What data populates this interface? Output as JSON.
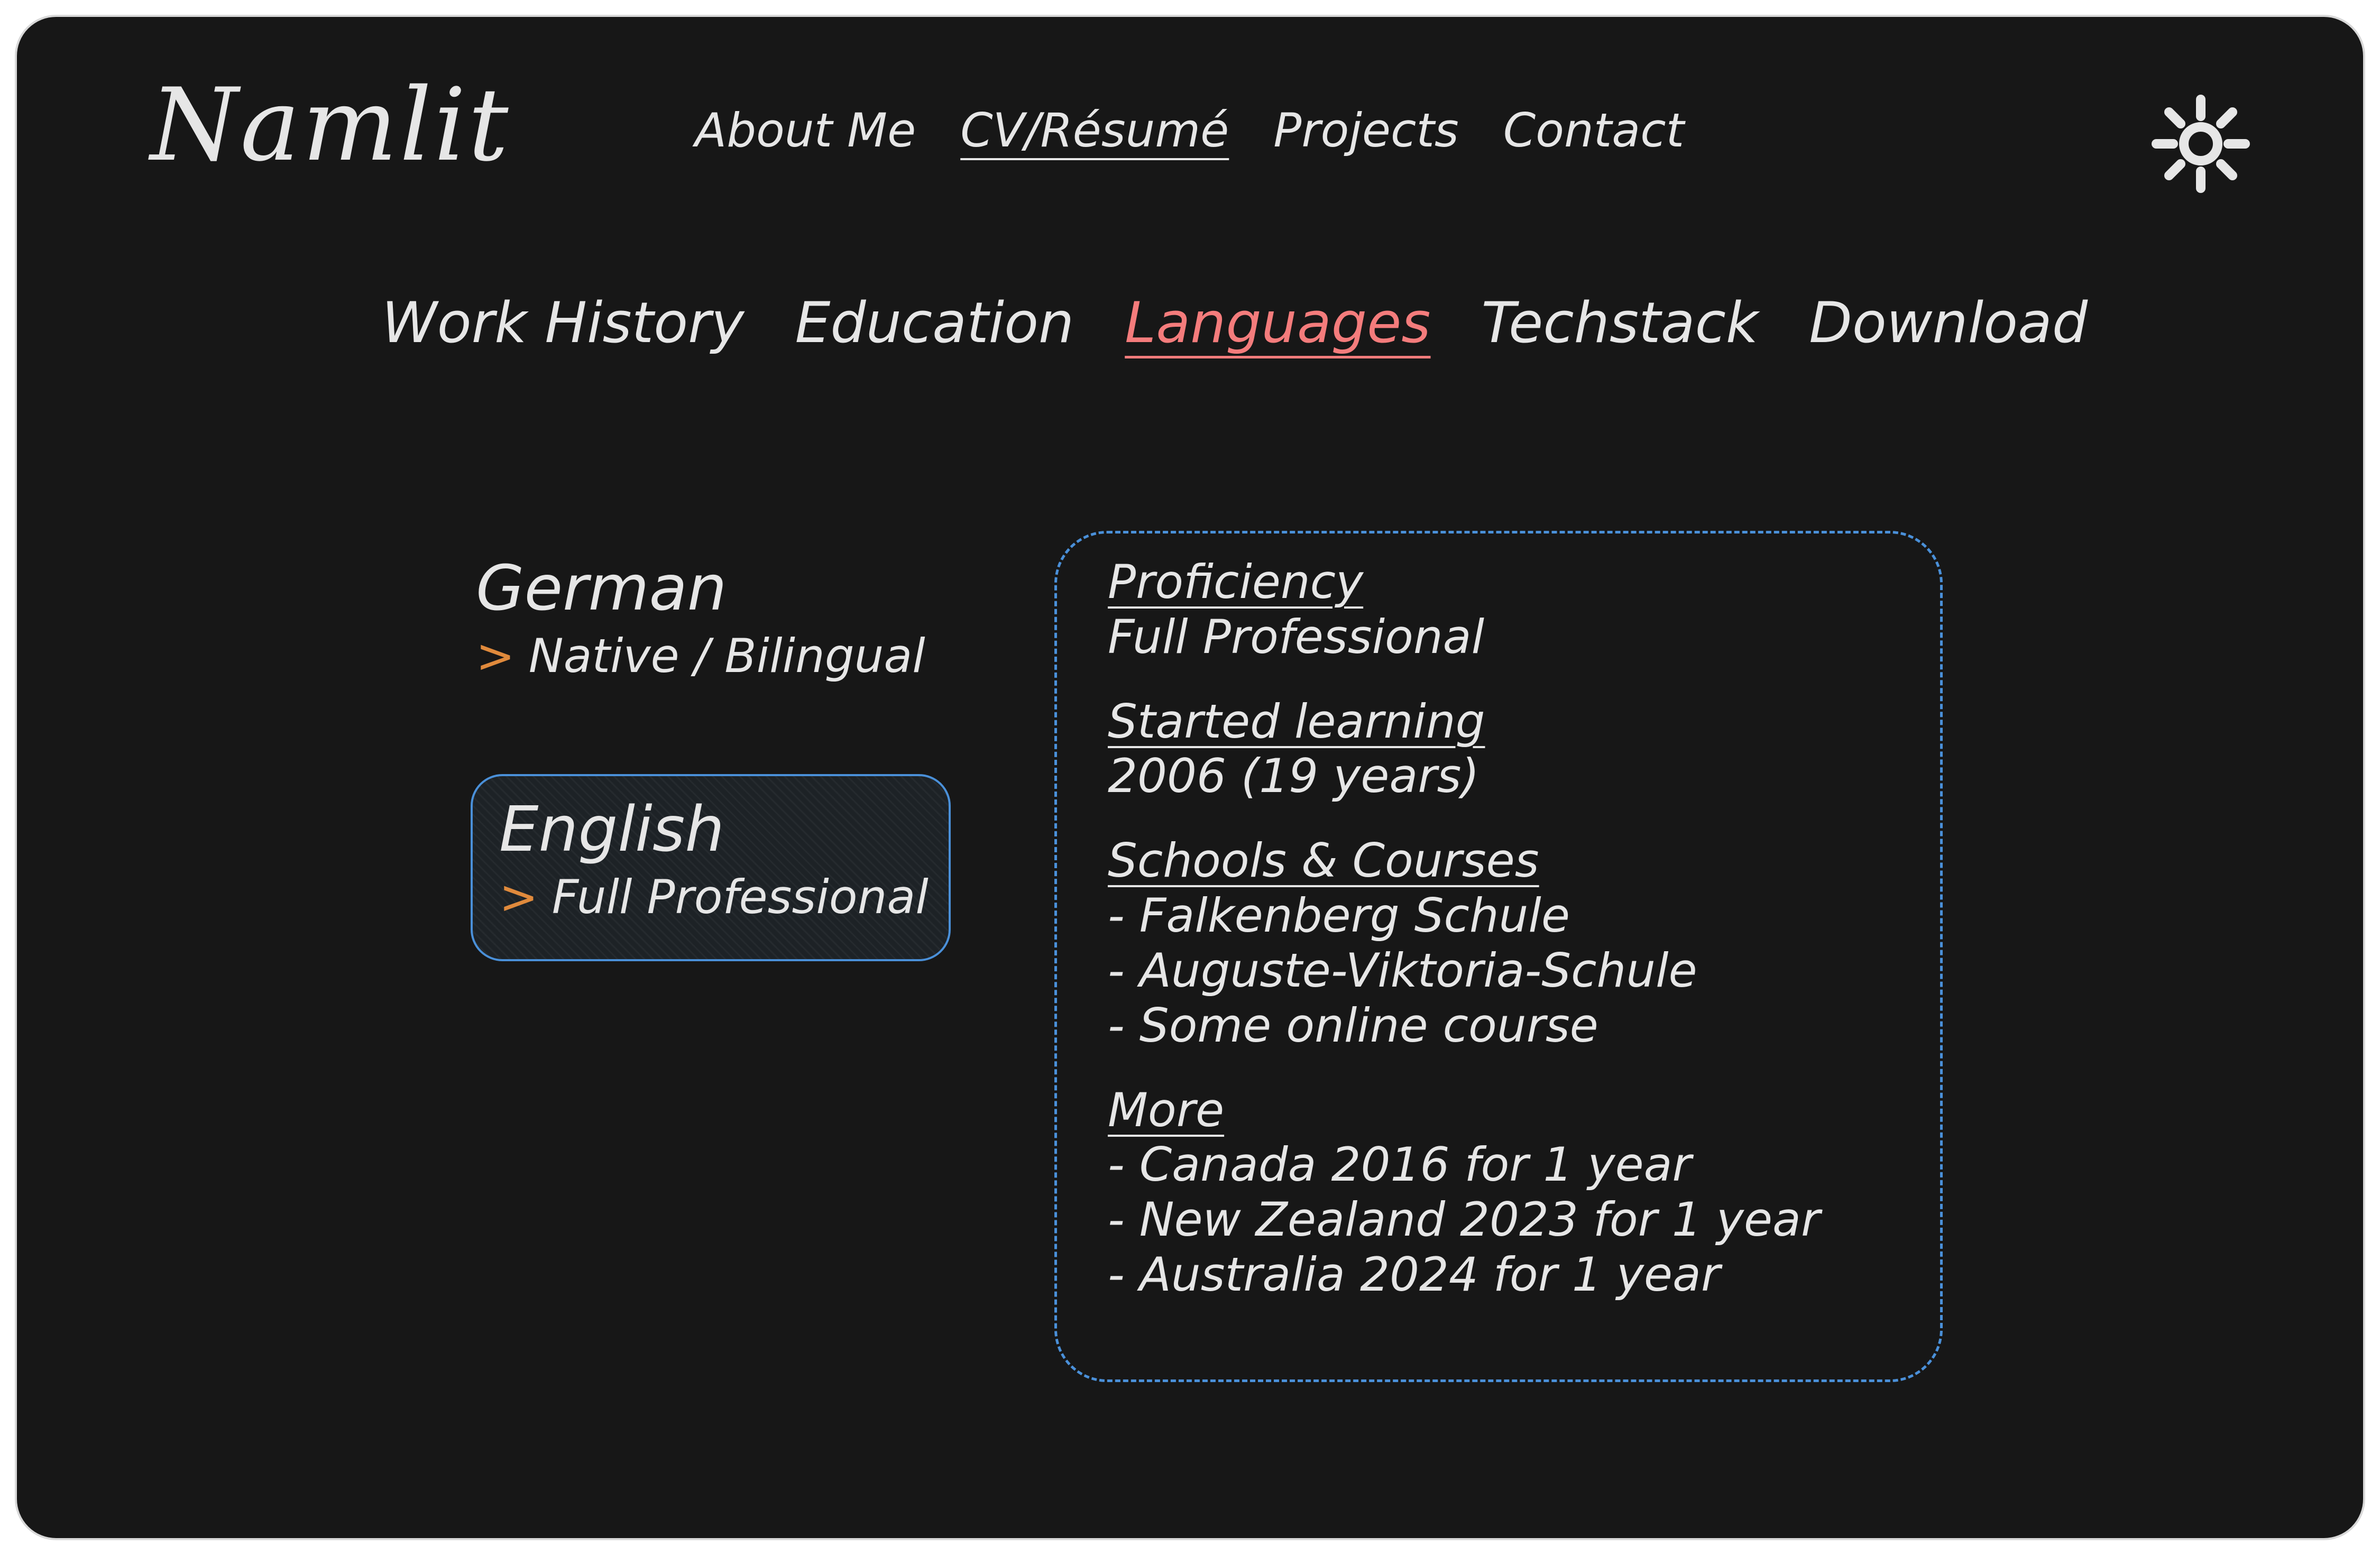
{
  "site": {
    "logo": "Namlit",
    "nav": [
      {
        "label": "About Me",
        "active": false
      },
      {
        "label": "CV/Résumé",
        "active": true
      },
      {
        "label": "Projects",
        "active": false
      },
      {
        "label": "Contact",
        "active": false
      }
    ],
    "theme_toggle_icon": "sun-icon"
  },
  "subnav": [
    {
      "label": "Work History",
      "active": false
    },
    {
      "label": "Education",
      "active": false
    },
    {
      "label": "Languages",
      "active": true
    },
    {
      "label": "Techstack",
      "active": false
    },
    {
      "label": "Download",
      "active": false
    }
  ],
  "languages": [
    {
      "name": "German",
      "level": "Native / Bilingual",
      "selected": false
    },
    {
      "name": "English",
      "level": "Full Professional",
      "selected": true
    }
  ],
  "details": {
    "proficiency_label": "Proficiency",
    "proficiency_value": "Full Professional",
    "started_label": "Started learning",
    "started_value": "2006 (19 years)",
    "schools_label": "Schools & Courses",
    "schools": [
      "- Falkenberg Schule",
      "- Auguste-Viktoria-Schule",
      "- Some online course"
    ],
    "more_label": "More",
    "more": [
      "- Canada 2016 for 1 year",
      "- New Zealand 2023 for 1 year",
      "- Australia 2024 for 1 year"
    ]
  },
  "colors": {
    "background": "#171717",
    "text": "#e6e6e6",
    "accent_active": "#f47c7c",
    "accent_border": "#4a90d9",
    "chevron": "#e08a3c"
  },
  "icons": {
    "chevron": ">"
  }
}
